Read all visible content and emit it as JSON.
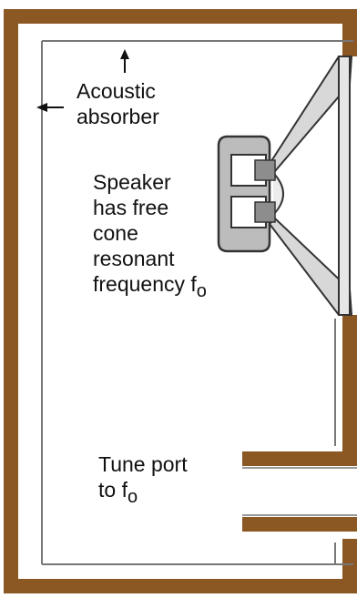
{
  "colors": {
    "enclosure_wall": "#8b5722",
    "absorber_line": "#777777",
    "speaker_body": "#bcbcbc",
    "speaker_outline": "#333333",
    "coil": "#8d8d8d",
    "background": "#ffffff",
    "text": "#111111"
  },
  "labels": {
    "absorber": [
      "Acoustic",
      "absorber"
    ],
    "speaker": [
      "Speaker",
      "has free",
      "cone",
      "resonant"
    ],
    "speaker_freq": {
      "text": "frequency f",
      "sub": "o"
    },
    "port": {
      "line1": "Tune port",
      "line2_text": "to f",
      "line2_sub": "o"
    }
  },
  "icons": {
    "speaker": "loudspeaker-cross-section",
    "arrows": "dimension-arrow"
  }
}
